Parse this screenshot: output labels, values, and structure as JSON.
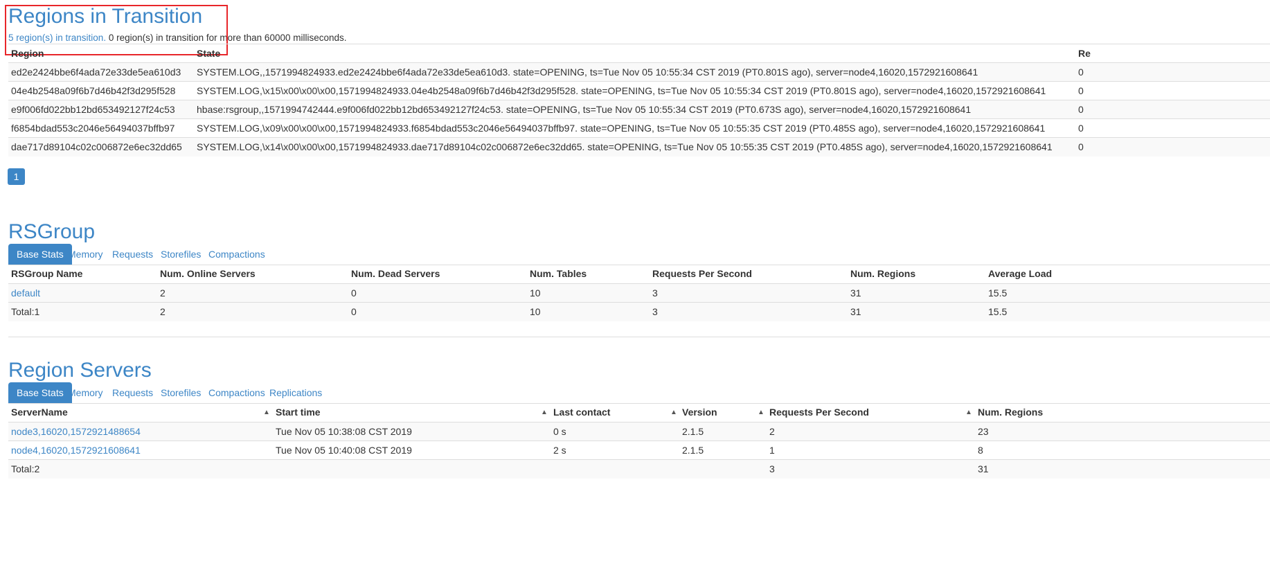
{
  "rit": {
    "title": "Regions in Transition",
    "summary_link": "5 region(s) in transition.",
    "summary_rest": " 0 region(s) in transition for more than 60000 milliseconds.",
    "headers": [
      "Region",
      "State",
      "Re"
    ],
    "rows": [
      {
        "region": "ed2e2424bbe6f4ada72e33de5ea610d3",
        "state": "SYSTEM.LOG,,1571994824933.ed2e2424bbe6f4ada72e33de5ea610d3. state=OPENING, ts=Tue Nov 05 10:55:34 CST 2019 (PT0.801S ago), server=node4,16020,1572921608641",
        "re": "0"
      },
      {
        "region": "04e4b2548a09f6b7d46b42f3d295f528",
        "state": "SYSTEM.LOG,\\x15\\x00\\x00\\x00,1571994824933.04e4b2548a09f6b7d46b42f3d295f528. state=OPENING, ts=Tue Nov 05 10:55:34 CST 2019 (PT0.801S ago), server=node4,16020,1572921608641",
        "re": "0"
      },
      {
        "region": "e9f006fd022bb12bd653492127f24c53",
        "state": "hbase:rsgroup,,1571994742444.e9f006fd022bb12bd653492127f24c53. state=OPENING, ts=Tue Nov 05 10:55:34 CST 2019 (PT0.673S ago), server=node4,16020,1572921608641",
        "re": "0"
      },
      {
        "region": "f6854bdad553c2046e56494037bffb97",
        "state": "SYSTEM.LOG,\\x09\\x00\\x00\\x00,1571994824933.f6854bdad553c2046e56494037bffb97. state=OPENING, ts=Tue Nov 05 10:55:35 CST 2019 (PT0.485S ago), server=node4,16020,1572921608641",
        "re": "0"
      },
      {
        "region": "dae717d89104c02c006872e6ec32dd65",
        "state": "SYSTEM.LOG,\\x14\\x00\\x00\\x00,1571994824933.dae717d89104c02c006872e6ec32dd65. state=OPENING, ts=Tue Nov 05 10:55:35 CST 2019 (PT0.485S ago), server=node4,16020,1572921608641",
        "re": "0"
      }
    ],
    "page": "1"
  },
  "rsgroup": {
    "title": "RSGroup",
    "tabs": [
      "Base Stats",
      "Memory",
      "Requests",
      "Storefiles",
      "Compactions"
    ],
    "headers": [
      "RSGroup Name",
      "Num. Online Servers",
      "Num. Dead Servers",
      "Num. Tables",
      "Requests Per Second",
      "Num. Regions",
      "Average Load"
    ],
    "rows": [
      [
        "default",
        "2",
        "0",
        "10",
        "3",
        "31",
        "15.5"
      ],
      [
        "Total:1",
        "2",
        "0",
        "10",
        "3",
        "31",
        "15.5"
      ]
    ]
  },
  "servers": {
    "title": "Region Servers",
    "tabs": [
      "Base Stats",
      "Memory",
      "Requests",
      "Storefiles",
      "Compactions",
      "Replications"
    ],
    "headers": [
      "ServerName",
      "Start time",
      "Last contact",
      "Version",
      "Requests Per Second",
      "Num. Regions"
    ],
    "rows": [
      [
        "node3,16020,1572921488654",
        "Tue Nov 05 10:38:08 CST 2019",
        "0 s",
        "2.1.5",
        "2",
        "23"
      ],
      [
        "node4,16020,1572921608641",
        "Tue Nov 05 10:40:08 CST 2019",
        "2 s",
        "2.1.5",
        "1",
        "8"
      ],
      [
        "Total:2",
        "",
        "",
        "",
        "3",
        "31"
      ]
    ]
  },
  "colors": {
    "accent": "#3d86c6",
    "highlight_box": "#e8262a"
  },
  "icons": {
    "sort": "sort-icon"
  }
}
